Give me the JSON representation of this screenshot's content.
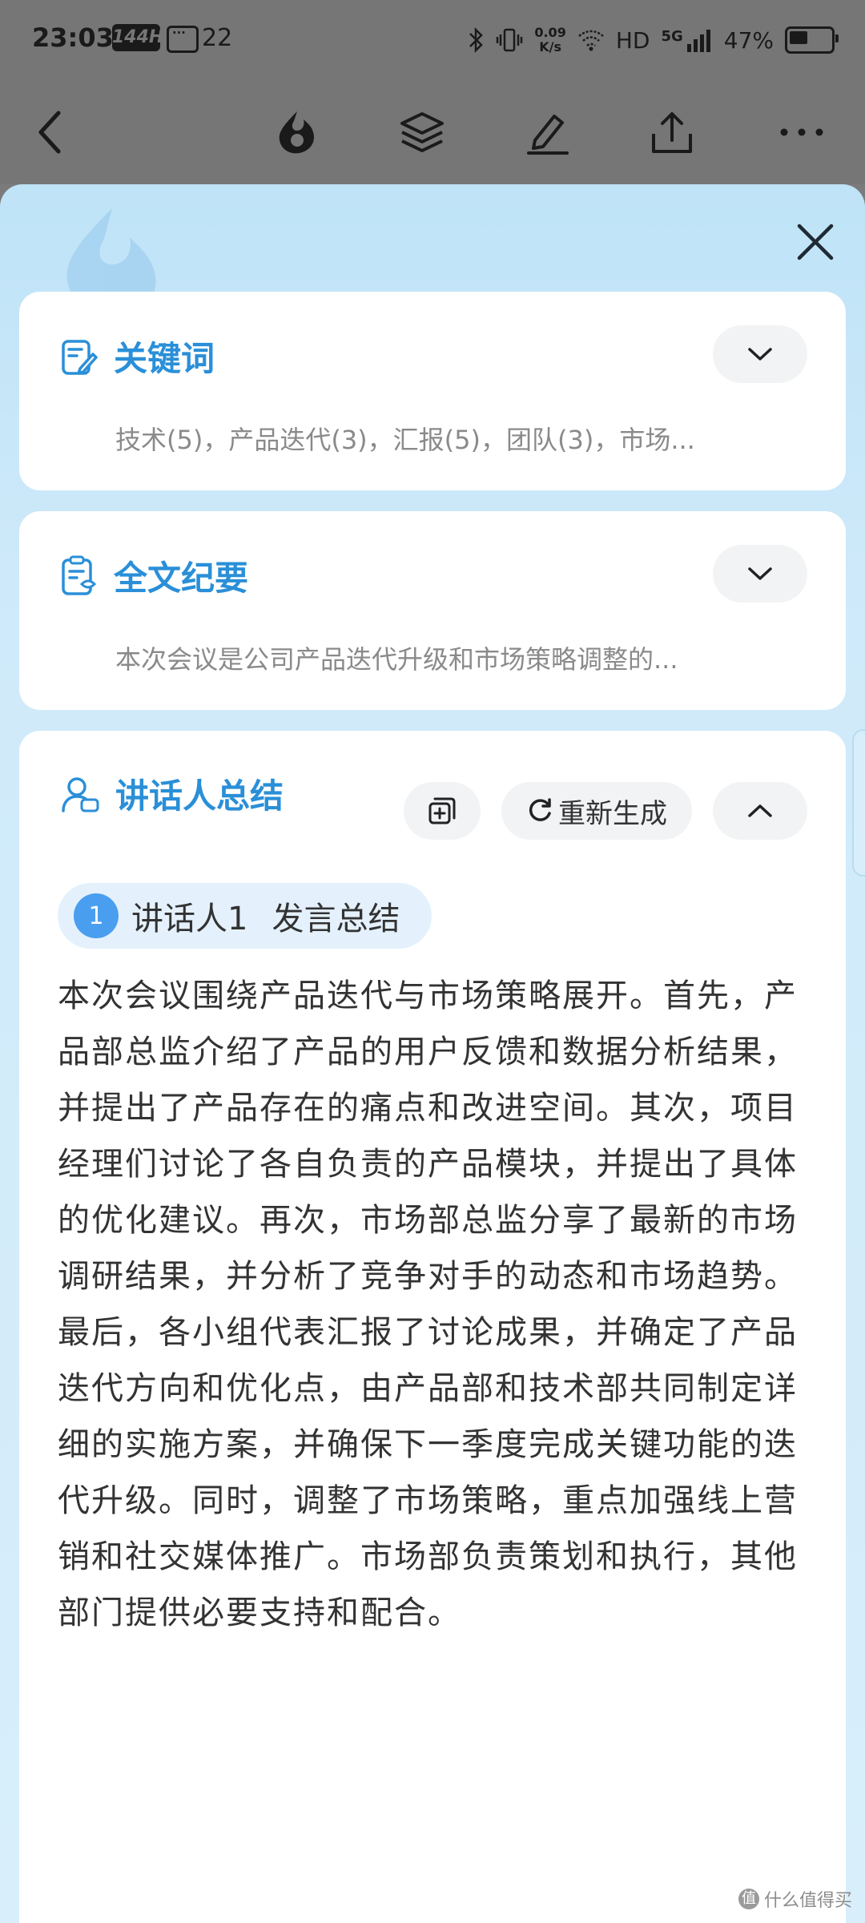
{
  "status_bar": {
    "time": "23:03",
    "refresh_badge": "144Hz",
    "message_count": "22",
    "net_speed_value": "0.09",
    "net_speed_unit": "K/s",
    "hd_label": "HD",
    "network_label": "5G",
    "battery_percent": "47%"
  },
  "toolbar": {
    "icons": [
      "back-icon",
      "logo-icon",
      "layers-icon",
      "edit-icon",
      "share-icon",
      "more-icon"
    ]
  },
  "cards": {
    "keywords": {
      "title": "关键词",
      "preview": "技术(5)，产品迭代(3)，汇报(5)，团队(3)，市场..."
    },
    "full_summary": {
      "title": "全文纪要",
      "preview": "本次会议是公司产品迭代升级和市场策略调整的..."
    },
    "speaker_summary": {
      "title": "讲话人总结",
      "regenerate_label": "重新生成",
      "speaker_number": "1",
      "speaker_name": "讲话人1",
      "speaker_sub": "发言总结",
      "summary": "本次会议围绕产品迭代与市场策略展开。首先，产品部总监介绍了产品的用户反馈和数据分析结果，并提出了产品存在的痛点和改进空间。其次，项目经理们讨论了各自负责的产品模块，并提出了具体的优化建议。再次，市场部总监分享了最新的市场调研结果，并分析了竞争对手的动态和市场趋势。最后，各小组代表汇报了讨论成果，并确定了产品迭代方向和优化点，由产品部和技术部共同制定详细的实施方案，并确保下一季度完成关键功能的迭代升级。同时，调整了市场策略，重点加强线上营销和社交媒体推广。市场部负责策划和执行，其他部门提供必要支持和配合。"
    }
  },
  "watermark": {
    "mark": "值",
    "text": "什么值得买"
  },
  "colors": {
    "accent": "#2a8fd8",
    "badge": "#4a9ef0"
  }
}
